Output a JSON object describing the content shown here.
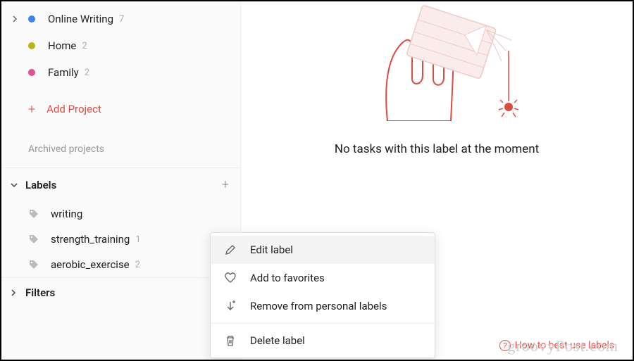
{
  "sidebar": {
    "projects": [
      {
        "name": "Online Writing",
        "count": "7",
        "color": "#3b82f6",
        "expanded": false,
        "has_chevron": true
      },
      {
        "name": "Home",
        "count": "2",
        "color": "#b8b319",
        "expanded": false,
        "has_chevron": false
      },
      {
        "name": "Family",
        "count": "2",
        "color": "#e05194",
        "expanded": false,
        "has_chevron": false
      }
    ],
    "add_project_label": "Add Project",
    "archived_label": "Archived projects",
    "labels_section": {
      "title": "Labels",
      "items": [
        {
          "name": "writing",
          "count": ""
        },
        {
          "name": "strength_training",
          "count": "1"
        },
        {
          "name": "aerobic_exercise",
          "count": "2"
        }
      ]
    },
    "filters_section": {
      "title": "Filters"
    }
  },
  "main": {
    "empty_message": "No tasks with this label at the moment",
    "help_link": "How to best use labels"
  },
  "context_menu": {
    "items": [
      {
        "icon": "pencil",
        "label": "Edit label"
      },
      {
        "icon": "heart",
        "label": "Add to favorites"
      },
      {
        "icon": "down-arrow-plus",
        "label": "Remove from personal labels"
      },
      {
        "icon": "trash",
        "label": "Delete label"
      }
    ],
    "hover_index": 0
  },
  "watermark": "groovyPost.com"
}
